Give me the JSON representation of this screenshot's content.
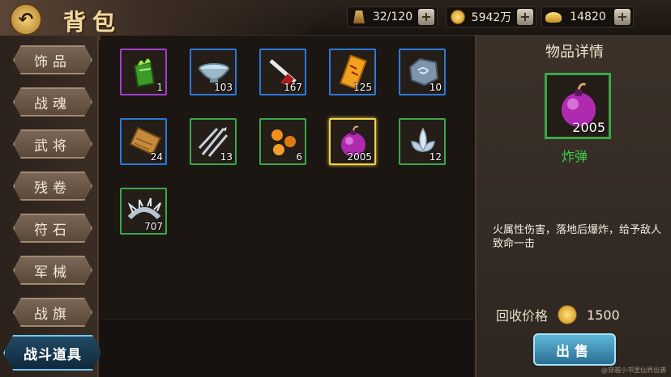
{
  "header": {
    "title": "背包",
    "resources": [
      {
        "name": "bag-capacity",
        "icon": "bag-icon",
        "value": "32/120"
      },
      {
        "name": "gold",
        "icon": "coin-icon",
        "value": "5942万"
      },
      {
        "name": "ingot",
        "icon": "ingot-icon",
        "value": "14820"
      }
    ]
  },
  "sidebar": {
    "tabs": [
      {
        "label": "饰品",
        "active": false
      },
      {
        "label": "战魂",
        "active": false
      },
      {
        "label": "武将",
        "active": false
      },
      {
        "label": "残卷",
        "active": false
      },
      {
        "label": "符石",
        "active": false
      },
      {
        "label": "军械",
        "active": false
      },
      {
        "label": "战旗",
        "active": false
      },
      {
        "label": "战斗道具",
        "active": true
      }
    ]
  },
  "items": [
    {
      "icon": "green-flame-book-icon",
      "qty": "1",
      "quality": "purple"
    },
    {
      "icon": "silver-bowl-icon",
      "qty": "103",
      "quality": "blue"
    },
    {
      "icon": "sword-scroll-icon",
      "qty": "167",
      "quality": "blue"
    },
    {
      "icon": "talisman-icon",
      "qty": "125",
      "quality": "blue"
    },
    {
      "icon": "cloud-stone-icon",
      "qty": "10",
      "quality": "blue"
    },
    {
      "icon": "scroll-icon",
      "qty": "24",
      "quality": "blue"
    },
    {
      "icon": "triple-dart-icon",
      "qty": "13",
      "quality": "green"
    },
    {
      "icon": "fire-orbs-icon",
      "qty": "6",
      "quality": "green"
    },
    {
      "icon": "bomb-icon",
      "qty": "2005",
      "quality": "green",
      "selected": true
    },
    {
      "icon": "lotus-icon",
      "qty": "12",
      "quality": "green"
    },
    {
      "icon": "spiked-ring-icon",
      "qty": "707",
      "quality": "green"
    }
  ],
  "detail": {
    "title": "物品详情",
    "item_icon": "bomb-icon",
    "qty": "2005",
    "name": "炸弹",
    "name_color": "#39d24a",
    "description": "火属性伤害，落地后爆炸，给予敌人致命一击",
    "price_label": "回收价格",
    "price_value": "1500",
    "sell_label": "出售"
  },
  "watermark": "@穿越小书里仙界出袭"
}
